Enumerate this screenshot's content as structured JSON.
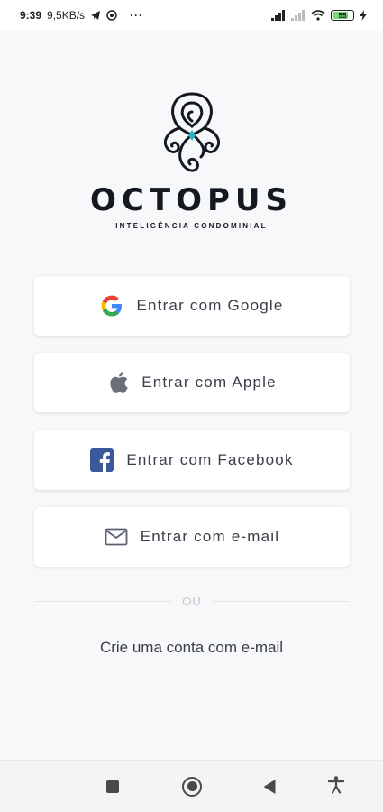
{
  "status_bar": {
    "time": "9:39",
    "network_speed": "9,5KB/s",
    "more": "···",
    "battery": "55"
  },
  "brand": {
    "name": "OCTOPUS",
    "subtitle": "INTELIGÊNCIA CONDOMINIAL"
  },
  "login": {
    "google": "Entrar com Google",
    "apple": "Entrar com Apple",
    "facebook": "Entrar com Facebook",
    "email": "Entrar com e-mail"
  },
  "divider": {
    "label": "OU"
  },
  "create_account": "Crie uma conta com e-mail",
  "colors": {
    "background": "#f7f8fa",
    "button_text": "#3a3d4a",
    "brand_dark": "#151821",
    "brand_accent": "#2fb3c9",
    "facebook_blue": "#3b5998"
  },
  "icons": {
    "google": "google-icon",
    "apple": "apple-icon",
    "facebook": "facebook-icon",
    "email": "envelope-icon"
  }
}
